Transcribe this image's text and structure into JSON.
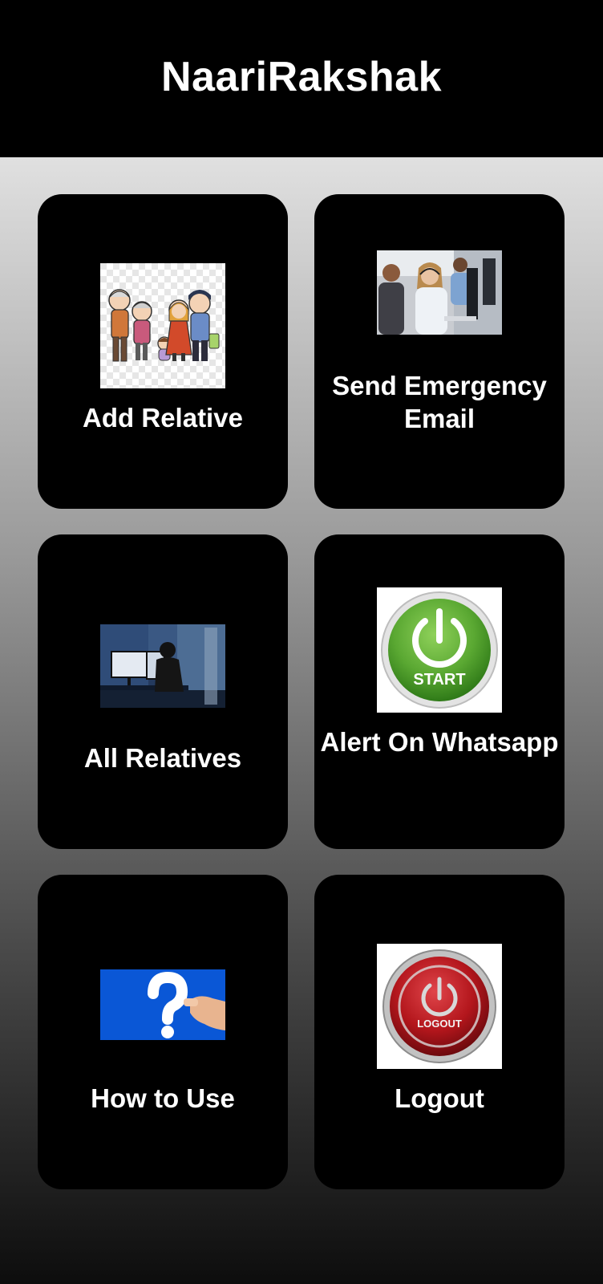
{
  "app": {
    "title": "NaariRakshak"
  },
  "colors": {
    "app_bar": "#000000",
    "tile_background": "#000000",
    "tile_text": "#ffffff",
    "gradient_top": "#e0e0e0",
    "gradient_bottom": "#0d0d0d",
    "start_green": "#5aa832",
    "logout_red": "#b3161c",
    "help_blue": "#0a57d6"
  },
  "tiles": [
    {
      "label": "Add Relative",
      "icon": "family-illustration"
    },
    {
      "label": "Send Emergency Email",
      "icon": "call-center-photo"
    },
    {
      "label": "All Relatives",
      "icon": "monitor-room-photo"
    },
    {
      "label": "Alert On Whatsapp",
      "icon": "start-power-button",
      "icon_text": "START"
    },
    {
      "label": "How to Use",
      "icon": "question-mark-card"
    },
    {
      "label": "Logout",
      "icon": "logout-power-button",
      "icon_text": "LOGOUT"
    }
  ]
}
